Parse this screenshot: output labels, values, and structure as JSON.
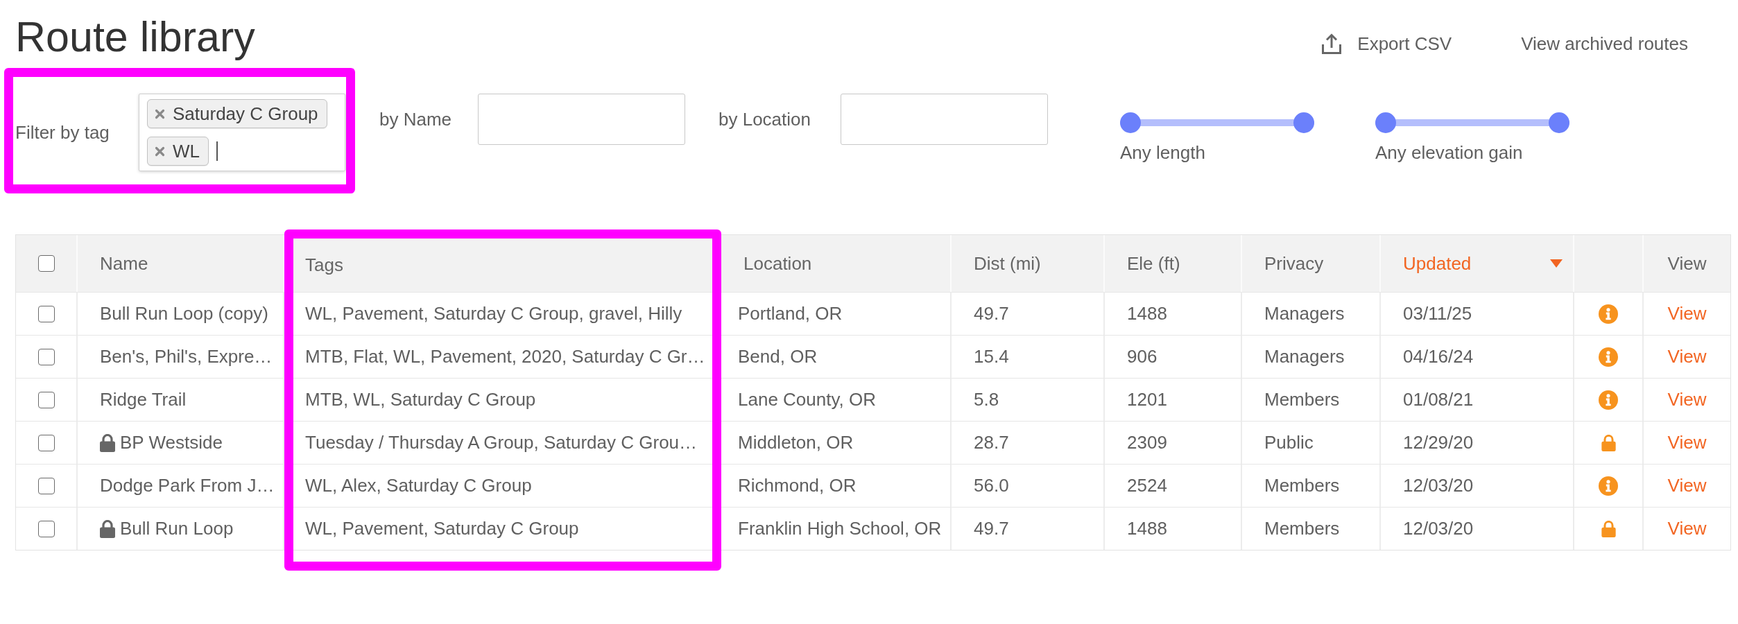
{
  "page": {
    "title": "Route library"
  },
  "actions": [
    {
      "kind": "export",
      "label": "Export CSV"
    },
    {
      "kind": "link",
      "label": "View archived routes"
    }
  ],
  "filters": {
    "tag_filter": {
      "label": "Filter by tag",
      "highlighted": true,
      "tags": [
        "Saturday C Group",
        "WL"
      ]
    },
    "fields": [
      {
        "label": "by Name"
      },
      {
        "label": "by Location"
      }
    ],
    "sliders": [
      {
        "label": "Any length",
        "level": 1
      },
      {
        "label": "Any elevation gain",
        "level": 1
      }
    ]
  },
  "table": {
    "columns": [
      {
        "kind": "select",
        "checked": false
      },
      {
        "kind": "text",
        "label": "Name",
        "sorted": false,
        "highlighted": false
      },
      {
        "kind": "text",
        "label": "Tags",
        "sorted": false,
        "highlighted": true
      },
      {
        "kind": "text",
        "label": "Location",
        "sorted": false,
        "highlighted": false
      },
      {
        "kind": "text",
        "label": "Dist (mi)",
        "sorted": false,
        "highlighted": false
      },
      {
        "kind": "text",
        "label": "Ele (ft)",
        "sorted": false,
        "highlighted": false
      },
      {
        "kind": "text",
        "label": "Privacy",
        "sorted": false,
        "highlighted": false
      },
      {
        "kind": "text",
        "label": "Updated",
        "sorted": true,
        "highlighted": false
      },
      {
        "kind": "status"
      },
      {
        "kind": "link",
        "label": "View"
      }
    ],
    "rows": [
      {
        "checked": false,
        "locked": false,
        "name": "Bull Run Loop (copy)",
        "tags": "WL, Pavement, Saturday C Group, gravel, Hilly",
        "location": "Portland, OR",
        "dist": "49.7",
        "ele": "1488",
        "privacy": "Managers",
        "updated": "03/11/25",
        "link": "View"
      },
      {
        "checked": false,
        "locked": false,
        "name": "Ben's, Phil's, Expre…",
        "tags": "MTB, Flat, WL, Pavement, 2020, Saturday C Gr…",
        "location": "Bend, OR",
        "dist": "15.4",
        "ele": "906",
        "privacy": "Managers",
        "updated": "04/16/24",
        "link": "View"
      },
      {
        "checked": false,
        "locked": false,
        "name": "Ridge Trail",
        "tags": "MTB, WL, Saturday C Group",
        "location": "Lane County, OR",
        "dist": "5.8",
        "ele": "1201",
        "privacy": "Members",
        "updated": "01/08/21",
        "link": "View"
      },
      {
        "checked": false,
        "locked": true,
        "name": "BP Westside",
        "tags": "Tuesday / Thursday A Group, Saturday C Grou…",
        "location": "Middleton, OR",
        "dist": "28.7",
        "ele": "2309",
        "privacy": "Public",
        "updated": "12/29/20",
        "link": "View"
      },
      {
        "checked": false,
        "locked": false,
        "name": "Dodge Park From J…",
        "tags": "WL, Alex, Saturday C Group",
        "location": "Richmond, OR",
        "dist": "56.0",
        "ele": "2524",
        "privacy": "Members",
        "updated": "12/03/20",
        "link": "View"
      },
      {
        "checked": false,
        "locked": true,
        "name": "Bull Run Loop",
        "tags": "WL, Pavement, Saturday C Group",
        "location": "Franklin High School, OR",
        "dist": "49.7",
        "ele": "1488",
        "privacy": "Members",
        "updated": "12/03/20",
        "link": "View"
      }
    ]
  }
}
